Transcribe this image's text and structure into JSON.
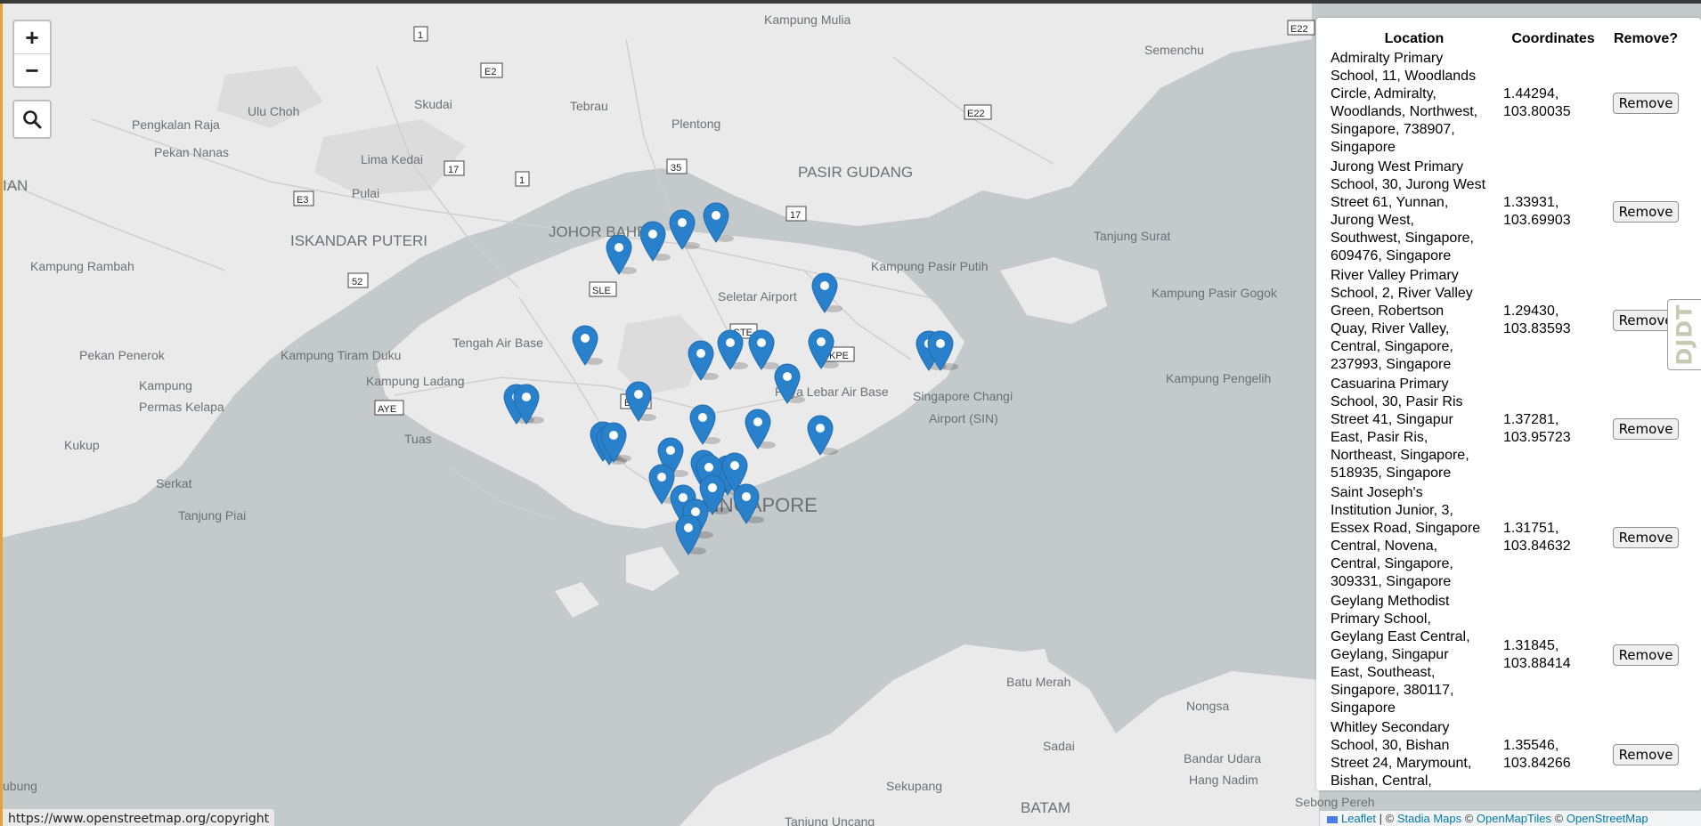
{
  "map": {
    "labels": {
      "kampung_mulia": "Kampung Mulia",
      "semenchu": "Semenchu",
      "ulu_choh": "Ulu Choh",
      "skudai": "Skudai",
      "tebrau": "Tebrau",
      "pengkalan_raja": "Pengkalan Raja",
      "plentong": "Plentong",
      "pekan_nanas": "Pekan Nanas",
      "lima_kedai": "Lima Kedai",
      "pasir_gudang": "PASIR GUDANG",
      "ian": "IAN",
      "pulai": "Pulai",
      "iskandar_puteri": "ISKANDAR PUTERI",
      "johor_bahru": "JOHOR BAHRU",
      "tanjung_surat": "Tanjung Surat",
      "kampung_rambah": "Kampung Rambah",
      "kampung_pasir_putih": "Kampung Pasir Putih",
      "seletar_airport": "Seletar Airport",
      "kampung_pasir_gogok": "Kampung Pasir Gogok",
      "pekan_penerok": "Pekan Penerok",
      "kampung_tiram_duku": "Kampung Tiram Duku",
      "tengah_air_base": "Tengah Air Base",
      "kampung_ladang": "Kampung Ladang",
      "paya_lebar_air_base": "Paya Lebar Air Base",
      "singapore_changi_airport": "Singapore Changi",
      "singapore_changi_airport_2": "Airport (SIN)",
      "kampung_pengelih": "Kampung Pengelih",
      "kampung_permas_kelapa": "Kampung",
      "kampung_permas_kelapa_2": "Permas Kelapa",
      "tuas": "Tuas",
      "kukup": "Kukup",
      "serkat": "Serkat",
      "singapore": "SINGAPORE",
      "tanjung_piai": "Tanjung Piai",
      "batu_merah": "Batu Merah",
      "nongsa": "Nongsa",
      "sadai": "Sadai",
      "bandar_udara": "Bandar Udara",
      "hang_nadim": "Hang Nadim",
      "sekupang": "Sekupang",
      "batam": "BATAM",
      "sebong_pereh": "Sebong Pereh",
      "tanjung_uncang": "Tanjung Uncang",
      "bubung": "ubung"
    },
    "road_shields": {
      "r1a": "1",
      "e22a": "E22",
      "e2": "E2",
      "e22b": "E22",
      "r17a": "17",
      "r1b": "1",
      "r35": "35",
      "e3": "E3",
      "r17b": "17",
      "r52": "52",
      "sle": "SLE",
      "cte": "CTE",
      "kpe": "KPE",
      "bke": "BKE",
      "aye": "AYE"
    },
    "marker_count": 26,
    "marker_color": "#2a81cb"
  },
  "controls": {
    "zoom_in": "+",
    "zoom_out": "−",
    "search_icon": "search-icon"
  },
  "panel": {
    "headers": {
      "location": "Location",
      "coordinates": "Coordinates",
      "remove": "Remove?"
    },
    "rows": [
      {
        "name_lines": [
          "Admiralty Primary",
          "School, 11, Woodlands",
          "Circle, Admiralty,",
          "Woodlands, Northwest,",
          "Singapore, 738907,",
          "Singapore"
        ],
        "coord_lines": [
          "1.44294,",
          "103.80035"
        ],
        "button": "Remove"
      },
      {
        "name_lines": [
          "Jurong West Primary",
          "School, 30, Jurong West",
          "Street 61, Yunnan,",
          "Jurong West,",
          "Southwest, Singapore,",
          "609476, Singapore"
        ],
        "coord_lines": [
          "1.33931,",
          "103.69903"
        ],
        "button": "Remove"
      },
      {
        "name_lines": [
          "River Valley Primary",
          "School, 2, River Valley",
          "Green, Robertson",
          "Quay, River Valley,",
          "Central, Singapore,",
          "237993, Singapore"
        ],
        "coord_lines": [
          "1.29430,",
          "103.83593"
        ],
        "button": "Remove"
      },
      {
        "name_lines": [
          "Casuarina Primary",
          "School, 30, Pasir Ris",
          "Street 41, Singapur",
          "East, Pasir Ris,",
          "Northeast, Singapore,",
          "518935, Singapore"
        ],
        "coord_lines": [
          "1.37281,",
          "103.95723"
        ],
        "button": "Remove"
      },
      {
        "name_lines": [
          "Saint Joseph's",
          "Institution Junior, 3,",
          "Essex Road, Singapore",
          "Central, Novena,",
          "Central, Singapore,",
          "309331, Singapore"
        ],
        "coord_lines": [
          "1.31751,",
          "103.84632"
        ],
        "button": "Remove"
      },
      {
        "name_lines": [
          "Geylang Methodist",
          "Primary School,",
          "Geylang East Central,",
          "Geylang, Singapur",
          "East, Southeast,",
          "Singapore, 380117,",
          "Singapore"
        ],
        "coord_lines": [
          "1.31845,",
          "103.88414"
        ],
        "button": "Remove"
      },
      {
        "name_lines": [
          "Whitley Secondary",
          "School, 30, Bishan",
          "Street 24, Marymount,",
          "Bishan, Central,"
        ],
        "coord_lines": [
          "1.35546,",
          "103.84266"
        ],
        "button": "Remove"
      }
    ]
  },
  "side_tab": {
    "text": "DJDT"
  },
  "status_url": "https://www.openstreetmap.org/copyright",
  "attribution": {
    "leaflet": "Leaflet",
    "sep1": " | © ",
    "stadia": "Stadia Maps",
    "sep2": " © ",
    "openmaptiles": "OpenMapTiles",
    "sep3": " © ",
    "osm": "OpenStreetMap"
  }
}
